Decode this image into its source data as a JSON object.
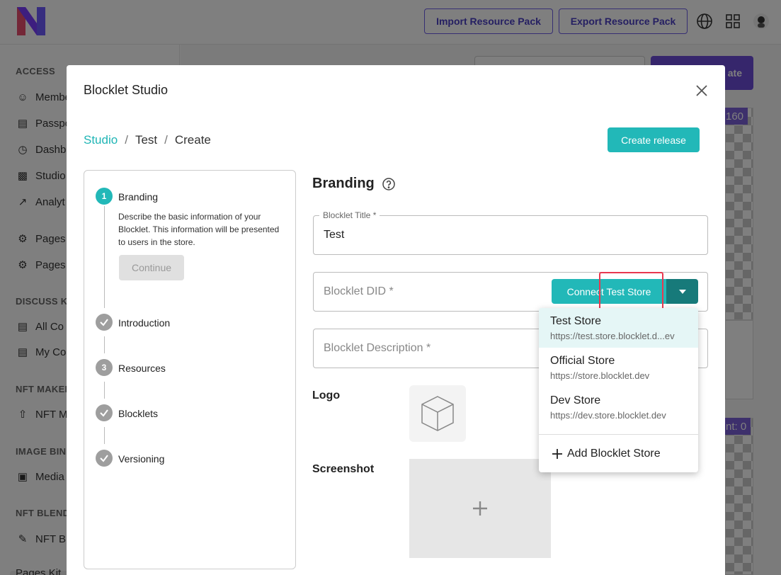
{
  "header": {
    "import_label": "Import Resource Pack",
    "export_label": "Export Resource Pack"
  },
  "sidebar": {
    "sections": [
      "ACCESS",
      "DISCUSS KI",
      "NFT MAKER",
      "IMAGE BIN",
      "NFT BLEND"
    ],
    "items": [
      "Membe",
      "Passpo",
      "Dashb",
      "Studio",
      "Analyt",
      "Pages",
      "Pages",
      "All Co",
      "My Co",
      "NFT M",
      "Media",
      "NFT Bl",
      "Pages Kit"
    ]
  },
  "background": {
    "create_label": "ate",
    "badge_top": "160",
    "badge_bottom": "nt: 0"
  },
  "modal": {
    "title": "Blocklet Studio",
    "breadcrumb": {
      "root": "Studio",
      "middle": "Test",
      "current": "Create"
    },
    "create_release_label": "Create release",
    "steps": [
      {
        "num": "1",
        "label": "Branding",
        "desc": "Describe the basic information of your Blocklet. This information will be presented to users in the store.",
        "continue_label": "Continue"
      },
      {
        "label": "Introduction"
      },
      {
        "num": "3",
        "label": "Resources"
      },
      {
        "label": "Blocklets"
      },
      {
        "label": "Versioning"
      }
    ],
    "section_title": "Branding",
    "fields": {
      "title_legend": "Blocklet Title *",
      "title_value": "Test",
      "did_placeholder": "Blocklet DID *",
      "desc_placeholder": "Blocklet Description *"
    },
    "connect_label": "Connect Test Store",
    "logo_label": "Logo",
    "screenshot_label": "Screenshot",
    "dropdown": {
      "stores": [
        {
          "name": "Test Store",
          "url": "https://test.store.blocklet.d...ev"
        },
        {
          "name": "Official Store",
          "url": "https://store.blocklet.dev"
        },
        {
          "name": "Dev Store",
          "url": "https://dev.store.blocklet.dev"
        }
      ],
      "add_label": "Add Blocklet Store"
    }
  },
  "colors": {
    "accent": "#22b8b8",
    "accent_dark": "#177a7a",
    "purple": "#6c4cd8",
    "highlight": "#e8384f"
  }
}
